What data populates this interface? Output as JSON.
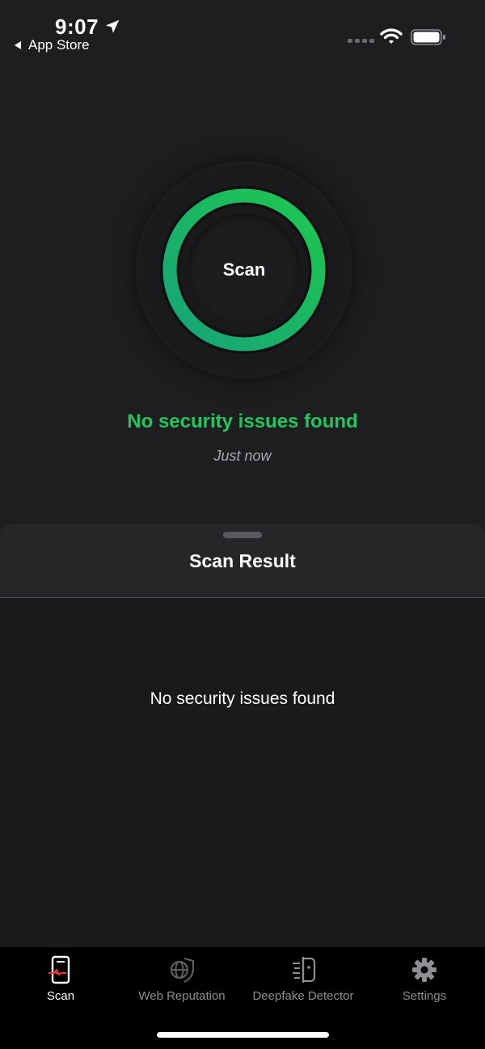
{
  "status_bar": {
    "time": "9:07",
    "back_app": "App Store"
  },
  "scan": {
    "button_label": "Scan",
    "status": "No security issues found",
    "last_scan": "Just now",
    "ring_color_start": "#16a37a",
    "ring_color_end": "#1ec84e"
  },
  "sheet": {
    "title": "Scan Result",
    "message": "No security issues found"
  },
  "tabs": [
    {
      "label": "Scan",
      "icon": "scan-phone-icon",
      "active": true
    },
    {
      "label": "Web Reputation",
      "icon": "globe-shield-icon",
      "active": false
    },
    {
      "label": "Deepfake Detector",
      "icon": "deepfake-icon",
      "active": false
    },
    {
      "label": "Settings",
      "icon": "gear-icon",
      "active": false
    }
  ],
  "colors": {
    "accent_green": "#22c55e",
    "background": "#1e1e20",
    "tab_inactive": "#8e8e93"
  }
}
